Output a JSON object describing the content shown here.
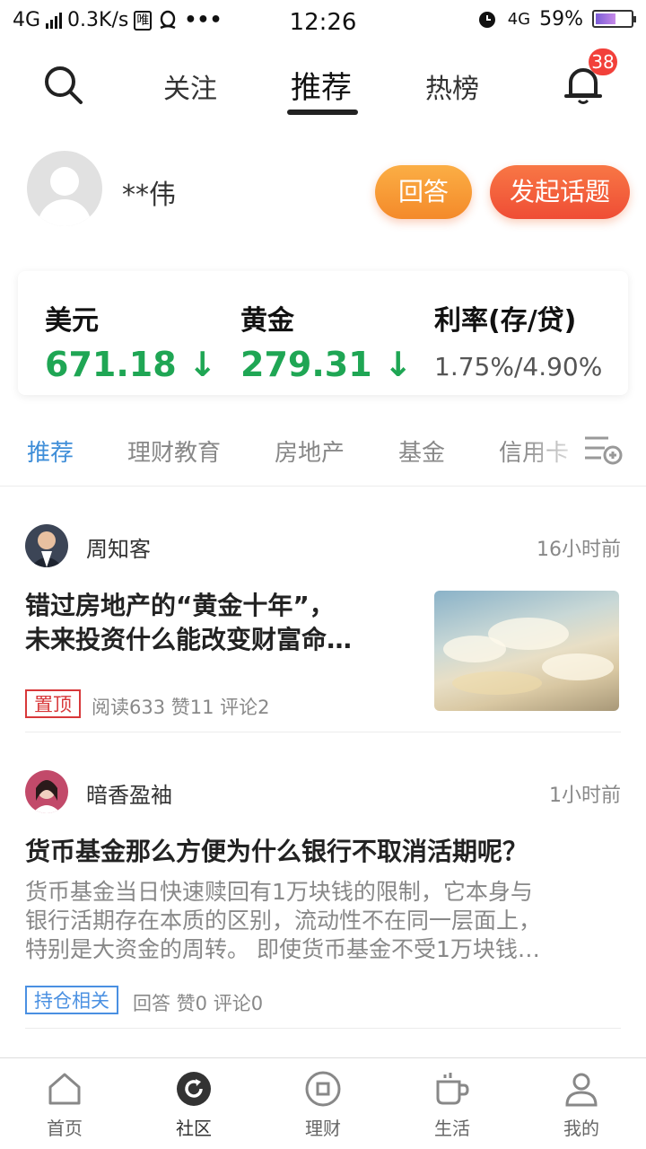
{
  "status_bar": {
    "network": "4G",
    "speed": "0.3K/s",
    "app_icon_text": "唯",
    "more": "•••",
    "time": "12:26",
    "net_right": "4G",
    "battery": "59%"
  },
  "header": {
    "tabs": [
      "关注",
      "推荐",
      "热榜"
    ],
    "active_tab": "推荐",
    "notification_count": "38"
  },
  "user": {
    "name": "**伟",
    "answer_label": "回答",
    "topic_label": "发起话题"
  },
  "rates": [
    {
      "name": "美元",
      "value": "671.18 ↓"
    },
    {
      "name": "黄金",
      "value": "279.31 ↓"
    },
    {
      "name": "利率(存/贷)",
      "value": "1.75%/4.90%"
    }
  ],
  "categories": [
    "推荐",
    "理财教育",
    "房地产",
    "基金",
    "信用卡"
  ],
  "posts": [
    {
      "author": "周知客",
      "time": "16小时前",
      "title_line1": "错过房地产的“黄金十年”，",
      "title_line2": "未来投资什么能改变财富命…",
      "tag": "置顶",
      "stats": "阅读633 赞11 评论2"
    },
    {
      "author": "暗香盈袖",
      "time": "1小时前",
      "title": "货币基金那么方便为什么银行不取消活期呢？",
      "desc_line1": "货币基金当日快速赎回有1万块钱的限制，它本身与",
      "desc_line2": "银行活期存在本质的区别，流动性不在同一层面上，",
      "desc_line3": "特别是大资金的周转。 即使货币基金不受1万块钱…",
      "tag": "持仓相关",
      "stats": "回答 赞0 评论0"
    }
  ],
  "bottom_nav": [
    "首页",
    "社区",
    "理财",
    "生活",
    "我的"
  ],
  "colors": {
    "up_down_green": "#1fa654",
    "accent_blue": "#3f8ed8",
    "badge_red": "#f2403a",
    "orange": "#f48a2a"
  }
}
